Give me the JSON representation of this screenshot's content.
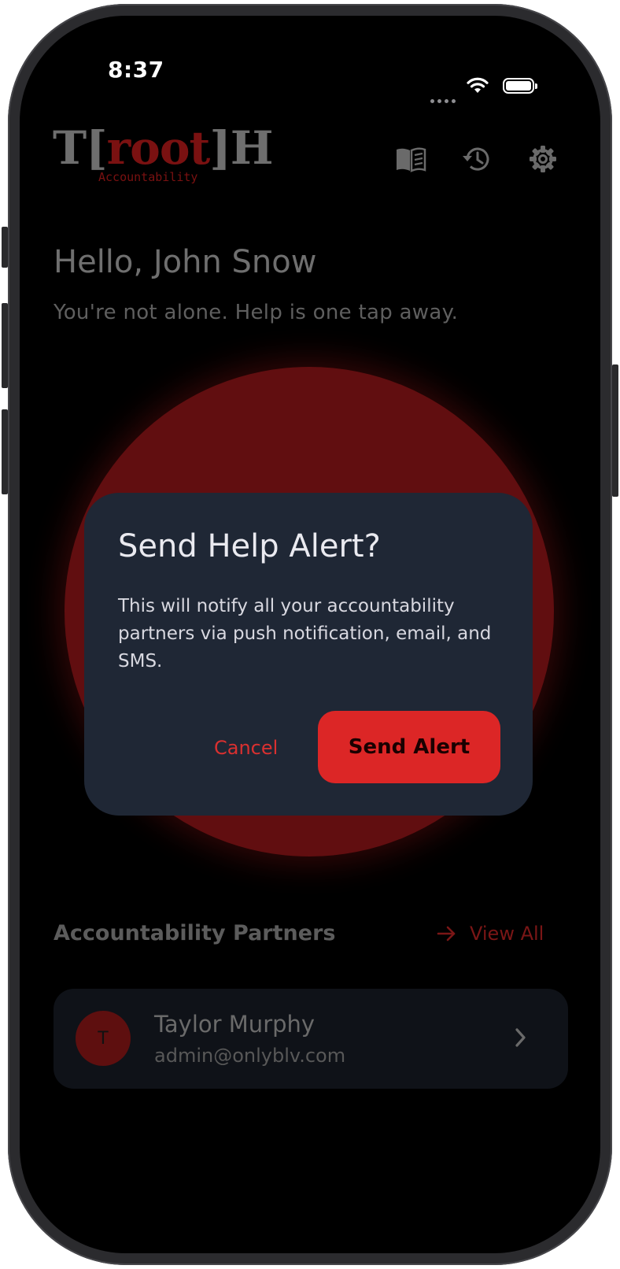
{
  "status_bar": {
    "time": "8:37"
  },
  "header": {
    "logo_left": "T[",
    "logo_root": "root",
    "logo_right": "]H",
    "logo_sub": "Accountability",
    "icons": [
      "book-icon",
      "history-icon",
      "gear-icon"
    ]
  },
  "greeting": {
    "title": "Hello, John Snow",
    "tagline": "You're not alone. Help is one tap away."
  },
  "dialog": {
    "title": "Send Help Alert?",
    "body": "This will notify all your accountability partners via push notification, email, and SMS.",
    "cancel_label": "Cancel",
    "confirm_label": "Send Alert"
  },
  "partners": {
    "title": "Accountability Partners",
    "view_all_label": "View All",
    "items": [
      {
        "initial": "T",
        "name": "Taylor Murphy",
        "email": "admin@onlyblv.com"
      }
    ]
  },
  "colors": {
    "accent": "#dc2626",
    "circle": "#610e10",
    "dialog_bg": "#1f2735"
  }
}
